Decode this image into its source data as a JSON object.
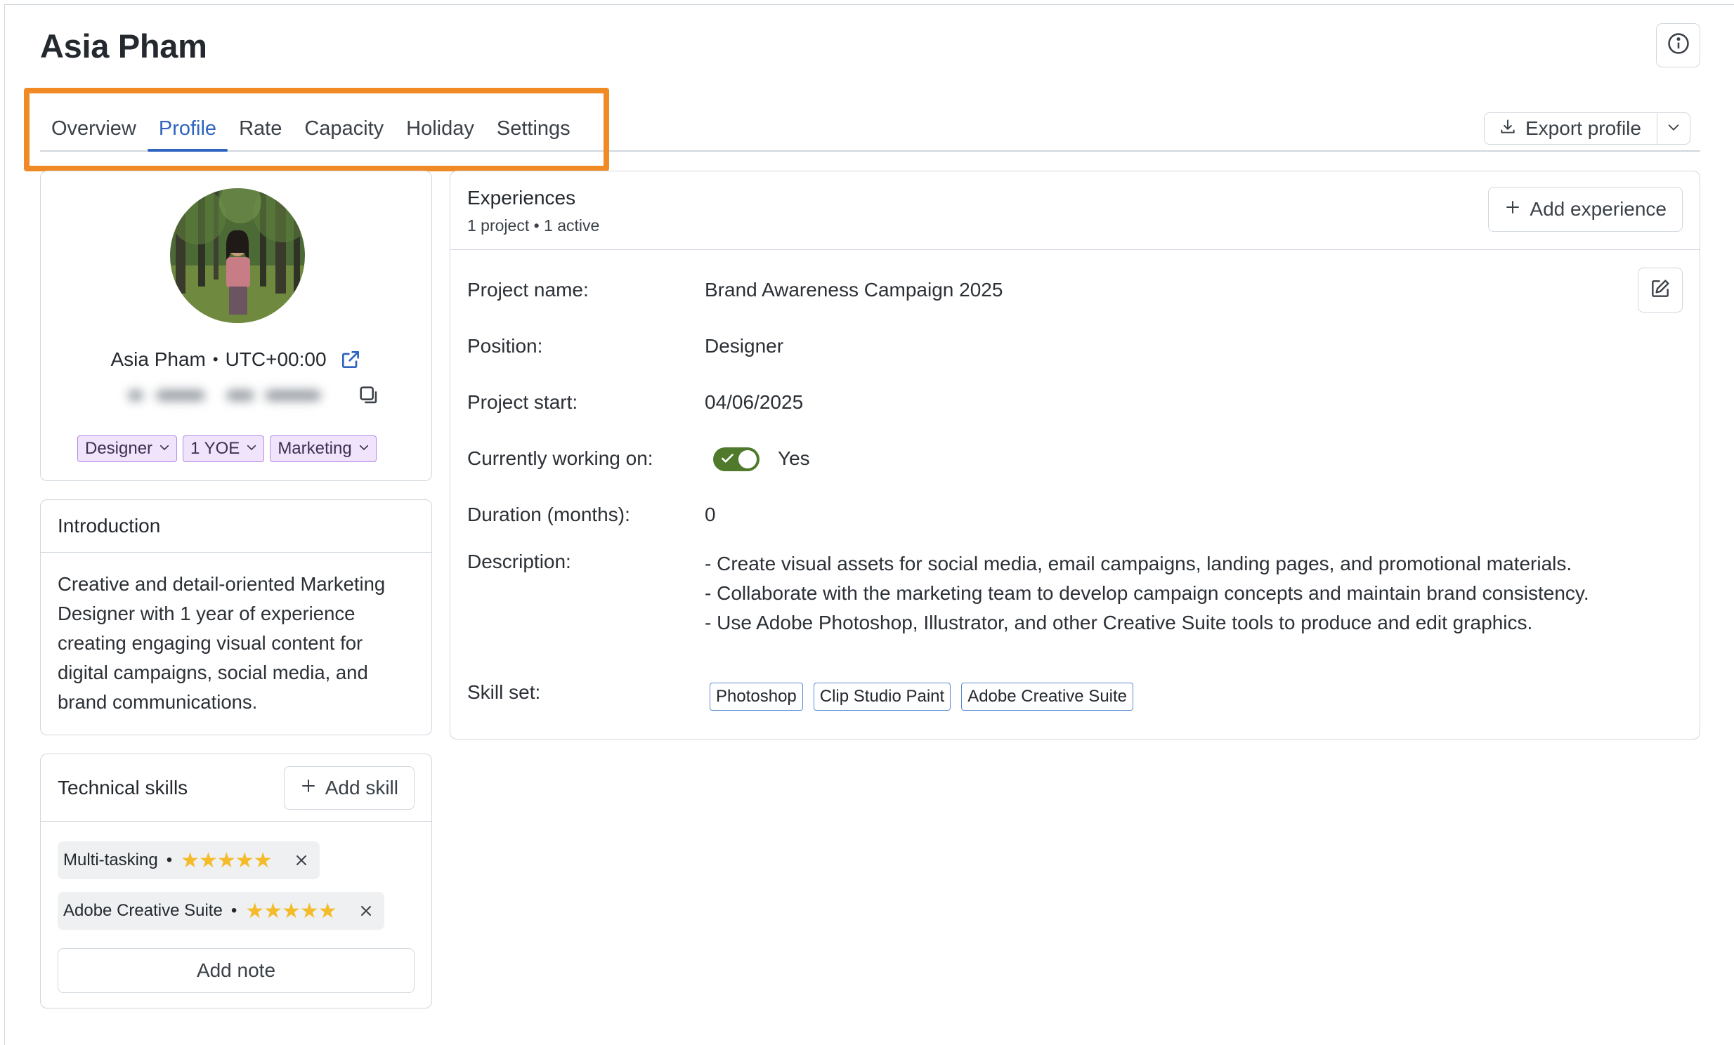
{
  "page": {
    "title": "Asia Pham"
  },
  "tabs": [
    {
      "label": "Overview",
      "active": false
    },
    {
      "label": "Profile",
      "active": true
    },
    {
      "label": "Rate",
      "active": false
    },
    {
      "label": "Capacity",
      "active": false
    },
    {
      "label": "Holiday",
      "active": false
    },
    {
      "label": "Settings",
      "active": false
    }
  ],
  "toolbar": {
    "export_label": "Export profile"
  },
  "profile": {
    "name": "Asia Pham",
    "separator": "•",
    "timezone": "UTC+00:00",
    "tags": [
      {
        "label": "Designer"
      },
      {
        "label": "1 YOE"
      },
      {
        "label": "Marketing"
      }
    ],
    "tag_color": "#f0e4fc"
  },
  "introduction": {
    "heading": "Introduction",
    "text": "Creative and detail-oriented Marketing Designer with 1 year of experience creating engaging visual content for digital campaigns, social media, and brand communications."
  },
  "technical_skills": {
    "heading": "Technical skills",
    "add_label": "Add skill",
    "items": [
      {
        "name": "Multi-tasking",
        "separator": "•",
        "rating": 5,
        "stars": "★★★★★"
      },
      {
        "name": "Adobe Creative Suite",
        "separator": "•",
        "rating": 5,
        "stars": "★★★★★"
      }
    ],
    "add_note_label": "Add note"
  },
  "experiences": {
    "heading": "Experiences",
    "summary": "1 project • 1 active",
    "add_label": "Add experience",
    "project": {
      "project_name_label": "Project name:",
      "project_name": "Brand Awareness Campaign 2025",
      "position_label": "Position:",
      "position": "Designer",
      "start_label": "Project start:",
      "start": "04/06/2025",
      "working_label": "Currently working on:",
      "working": "Yes",
      "working_on": true,
      "duration_label": "Duration (months):",
      "duration": "0",
      "description_label": "Description:",
      "description": [
        "- Create visual assets for social media, email campaigns, landing pages, and promotional materials.",
        "- Collaborate with the marketing team to develop campaign concepts and maintain brand consistency.",
        "- Use Adobe Photoshop, Illustrator, and other Creative Suite tools to produce and edit graphics."
      ],
      "skills_label": "Skill set:",
      "skills": [
        "Photoshop",
        "Clip Studio Paint",
        "Adobe Creative Suite"
      ]
    }
  },
  "colors": {
    "accent": "#2f64c0",
    "highlight_border": "#f08a24",
    "toggle_on": "#4f7a2b",
    "star": "#f4bb2a",
    "skill_tag_border": "#5b8ed6"
  },
  "icons": [
    "info-icon",
    "download-icon",
    "chevron-down-icon",
    "external-link-icon",
    "copy-icon",
    "plus-icon",
    "close-icon",
    "edit-icon",
    "check-icon"
  ]
}
